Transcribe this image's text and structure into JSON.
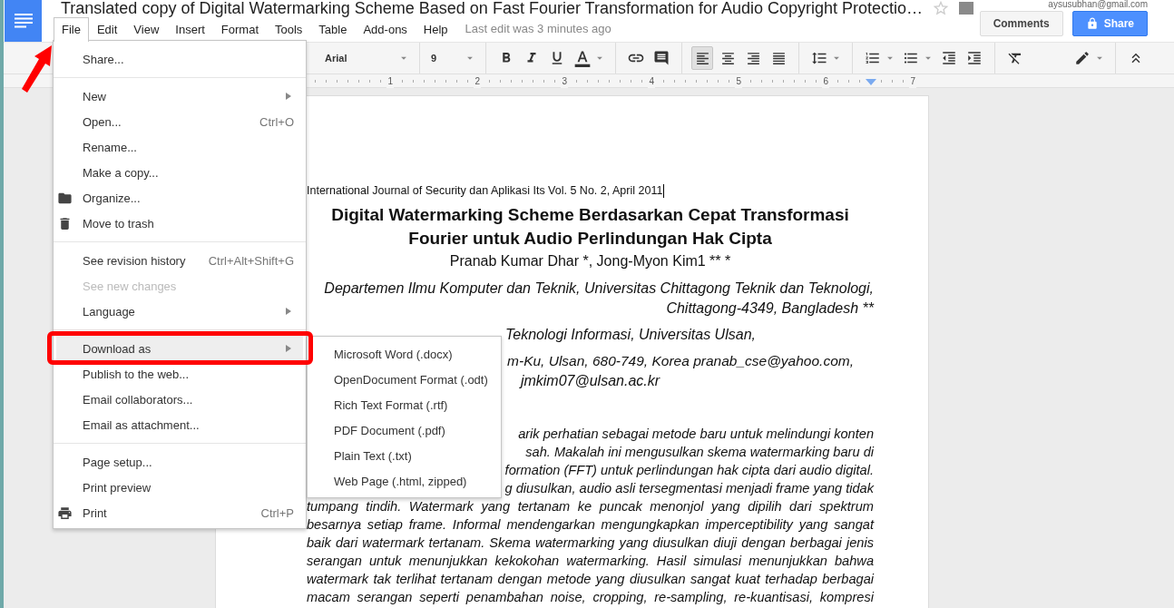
{
  "app": {
    "title": "Translated copy of Digital Watermarking Scheme Based on Fast Fourier Transformation for Audio Copyright Protectio…",
    "account": "aysusubhan@gmail.com",
    "starred": false,
    "last_edit": "Last edit was 3 minutes ago"
  },
  "menubar": [
    {
      "label": "File",
      "selected": true
    },
    {
      "label": "Edit",
      "selected": false
    },
    {
      "label": "View",
      "selected": false
    },
    {
      "label": "Insert",
      "selected": false
    },
    {
      "label": "Format",
      "selected": false
    },
    {
      "label": "Tools",
      "selected": false
    },
    {
      "label": "Table",
      "selected": false
    },
    {
      "label": "Add-ons",
      "selected": false
    },
    {
      "label": "Help",
      "selected": false
    }
  ],
  "header_buttons": [
    {
      "kind": "comments",
      "label": "Comments"
    },
    {
      "kind": "share",
      "label": "Share"
    }
  ],
  "toolbar": {
    "font": "Arial",
    "size": "9",
    "alignments": [
      {
        "kind": "left",
        "selected": true
      },
      {
        "kind": "center",
        "selected": false
      },
      {
        "kind": "right",
        "selected": false
      },
      {
        "kind": "justify",
        "selected": false
      }
    ]
  },
  "ruler": {
    "marks": [
      "1",
      "2",
      "3",
      "4",
      "5",
      "6",
      "7"
    ]
  },
  "document": {
    "lines": [
      {
        "kind": "header",
        "text": "International Journal of Security dan Aplikasi Its Vol. 5 No. 2, April 2011"
      },
      {
        "kind": "title",
        "text": "Digital Watermarking Scheme Berdasarkan Cepat Transformasi"
      },
      {
        "kind": "title",
        "text": "Fourier untuk Audio Perlindungan Hak Cipta"
      },
      {
        "kind": "authors",
        "text": "Pranab Kumar Dhar *, Jong-Myon Kim1 ** *"
      },
      {
        "kind": "affiliation",
        "text": "Departemen Ilmu Komputer dan Teknik, Universitas Chittagong Teknik dan Teknologi,"
      },
      {
        "kind": "affiliation",
        "text": "Chittagong-4349, Bangladesh **"
      },
      {
        "kind": "institution",
        "text": "Teknologi Informasi, Universitas Ulsan,"
      },
      {
        "kind": "address_fragment",
        "text": "m-Ku, Ulsan, 680-749, Korea pranab_cse@yahoo.com,"
      },
      {
        "kind": "address",
        "text": "jmkim07@ulsan.ac.kr"
      },
      {
        "kind": "body_fragment",
        "text": "arik perhatian sebagai metode baru untuk melindungi konten"
      },
      {
        "kind": "body_fragment",
        "text": "sah. Makalah ini mengusulkan skema watermarking baru di"
      },
      {
        "kind": "body_fragment",
        "text": "formation (FFT) untuk perlindungan hak cipta dari audio digital."
      },
      {
        "kind": "body_fragment",
        "text": "g diusulkan, audio asli tersegmentasi menjadi frame yang tidak"
      },
      {
        "kind": "body",
        "text": "tumpang tindih. Watermark yang tertanam ke puncak menonjol yang dipilih dari spektrum"
      },
      {
        "kind": "body",
        "text": "besarnya setiap frame. Informal mendengarkan mengungkapkan imperceptibility yang sangat"
      },
      {
        "kind": "body",
        "text": "baik dari watermark tertanam. Skema watermarking yang diusulkan diuji dengan berbagai jenis"
      },
      {
        "kind": "body",
        "text": "serangan untuk menunjukkan kekokohan watermarking. Hasil simulasi menunjukkan bahwa"
      },
      {
        "kind": "body",
        "text": "watermark tak terlihat tertanam dengan metode yang diusulkan sangat kuat terhadap berbagai"
      },
      {
        "kind": "body",
        "text": "macam serangan seperti penambahan noise, cropping, re-sampling, re-kuantisasi, kompresi"
      }
    ]
  },
  "file_menu": {
    "items": [
      {
        "kind": "plain",
        "label": "Share...",
        "submenu": false,
        "disabled": false,
        "selected": false
      },
      {
        "kind": "separator"
      },
      {
        "kind": "plain",
        "label": "New",
        "submenu": true,
        "disabled": false,
        "selected": false
      },
      {
        "kind": "plain",
        "label": "Open...",
        "shortcut": "Ctrl+O",
        "submenu": false,
        "disabled": false,
        "selected": false
      },
      {
        "kind": "plain",
        "label": "Rename...",
        "submenu": false,
        "disabled": false,
        "selected": false
      },
      {
        "kind": "plain",
        "label": "Make a copy...",
        "submenu": false,
        "disabled": false,
        "selected": false
      },
      {
        "kind": "organize",
        "label": "Organize...",
        "submenu": false,
        "disabled": false,
        "selected": false
      },
      {
        "kind": "trash",
        "label": "Move to trash",
        "submenu": false,
        "disabled": false,
        "selected": false
      },
      {
        "kind": "separator"
      },
      {
        "kind": "plain",
        "label": "See revision history",
        "shortcut": "Ctrl+Alt+Shift+G",
        "submenu": false,
        "disabled": false,
        "selected": false
      },
      {
        "kind": "plain",
        "label": "See new changes",
        "submenu": false,
        "disabled": true,
        "selected": false
      },
      {
        "kind": "plain",
        "label": "Language",
        "submenu": true,
        "disabled": false,
        "selected": false
      },
      {
        "kind": "separator"
      },
      {
        "kind": "plain",
        "label": "Download as",
        "submenu": true,
        "disabled": false,
        "selected": true
      },
      {
        "kind": "plain",
        "label": "Publish to the web...",
        "submenu": false,
        "disabled": false,
        "selected": false
      },
      {
        "kind": "plain",
        "label": "Email collaborators...",
        "submenu": false,
        "disabled": false,
        "selected": false
      },
      {
        "kind": "plain",
        "label": "Email as attachment...",
        "submenu": false,
        "disabled": false,
        "selected": false
      },
      {
        "kind": "separator"
      },
      {
        "kind": "plain",
        "label": "Page setup...",
        "submenu": false,
        "disabled": false,
        "selected": false
      },
      {
        "kind": "plain",
        "label": "Print preview",
        "submenu": false,
        "disabled": false,
        "selected": false
      },
      {
        "kind": "print",
        "label": "Print",
        "shortcut": "Ctrl+P",
        "submenu": false,
        "disabled": false,
        "selected": false
      }
    ]
  },
  "download_submenu": {
    "items": [
      "Microsoft Word (.docx)",
      "OpenDocument Format (.odt)",
      "Rich Text Format (.rtf)",
      "PDF Document (.pdf)",
      "Plain Text (.txt)",
      "Web Page (.html, zipped)"
    ]
  }
}
